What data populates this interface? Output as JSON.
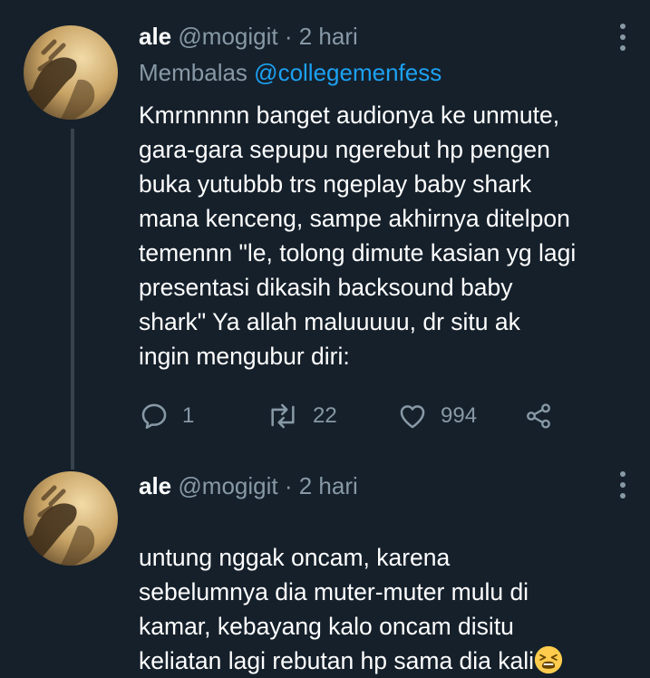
{
  "tweets": [
    {
      "display_name": "ale",
      "handle": "@mogigit",
      "separator": "·",
      "time": "2 hari",
      "reply_prefix": "Membalas",
      "reply_to": "@collegemenfess",
      "text": "Kmrnnnnn banget audionya ke unmute,\ngara-gara sepupu ngerebut hp pengen\nbuka yutubbb trs ngeplay baby shark\nmana kenceng, sampe akhirnya ditelpon\ntemennn \"le, tolong dimute kasian yg lagi\npresentasi dikasih backsound baby\nshark\"  Ya allah maluuuuu, dr situ ak\ningin mengubur diri:",
      "actions": {
        "replies": "1",
        "retweets": "22",
        "likes": "994"
      },
      "icons": [
        "reply-icon",
        "retweet-icon",
        "like-icon",
        "share-icon",
        "more-options-icon"
      ]
    },
    {
      "display_name": "ale",
      "handle": "@mogigit",
      "separator": "·",
      "time": "2 hari",
      "text": "untung nggak oncam, karena\nsebelumnya dia muter-muter mulu di\nkamar, kebayang kalo oncam disitu\nkeliatan lagi rebutan hp sama dia kali",
      "emoji": "tired-face-emoji"
    }
  ],
  "colors": {
    "background": "#15202b",
    "text": "#ffffff",
    "muted": "#8899a6",
    "link": "#1da1f2",
    "thread_line": "#38444d"
  }
}
